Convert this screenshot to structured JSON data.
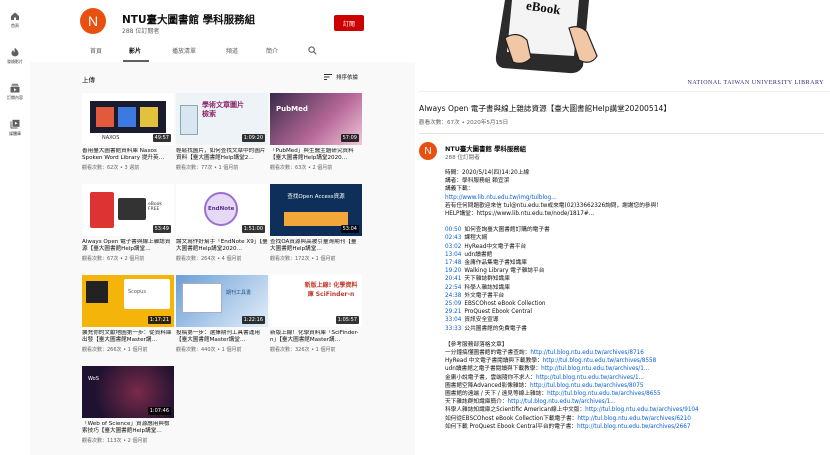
{
  "sidebar": {
    "items": [
      {
        "icon": "home-icon",
        "label": "首頁"
      },
      {
        "icon": "explore-icon",
        "label": "發燒影片"
      },
      {
        "icon": "subscriptions-icon",
        "label": "訂閱內容"
      },
      {
        "icon": "library-icon",
        "label": "媒體庫"
      }
    ]
  },
  "channel": {
    "avatar_letter": "N",
    "name": "NTU臺大圖書館 學科服務組",
    "subscribers": "288 位訂閱者",
    "subscribe_label": "訂閱",
    "tabs": [
      "首頁",
      "影片",
      "播放清單",
      "頻道",
      "簡介"
    ],
    "active_tab": "影片",
    "section_title": "上傳",
    "sort_label": "排序依據",
    "videos": [
      {
        "title": "善用臺大圖書館資料庫 Naxos Spoken Word Library 提升英…",
        "meta": "觀看次數：62次 • 3 週前",
        "duration": "49:57"
      },
      {
        "title": "輕鬆找圖片，如何查找文章中的圖片資料【臺大圖書館Help講堂2…",
        "meta": "觀看次數：77次 • 1 個月前",
        "duration": "1:09:20"
      },
      {
        "title": "「PubMed」與生醫主題研究資料【臺大圖書館Help講堂2020…",
        "meta": "觀看次數：63次 • 2 個月前",
        "duration": "57:09"
      },
      {
        "title": "Always Open 電子書與線上雜誌資源【臺大圖書館Help講堂…",
        "meta": "觀看次數：67次 • 2 個月前",
        "duration": "53:49"
      },
      {
        "title": "論文寫作好幫手「EndNote X9」【臺大圖書館Help講堂2020…",
        "meta": "觀看次數：264次 • 4 個月前",
        "duration": "1:51:00"
      },
      {
        "title": "查找OA資源與高被引臺灣期刊【臺大圖書館Help講堂…",
        "meta": "觀看次數：172次 • 1 個月前",
        "duration": "53:04"
      },
      {
        "title": "擴充你的文獻地圖第一步：從資料庫出發【臺大圖書館Master講…",
        "meta": "觀看次數：266次 • 1 個月前",
        "duration": "1:17:21"
      },
      {
        "title": "投稿第一步：選擇期刊工具書運用【臺大圖書館Master講堂…",
        "meta": "觀看次數：440次 • 1 個月前",
        "duration": "1:22:16"
      },
      {
        "title": "新版上線！化學資料庫「SciFinder-n」【臺大圖書館Master講…",
        "meta": "觀看次數：326次 • 1 個月前",
        "duration": "1:05:57"
      },
      {
        "title": "「Web of Science」資源應用與檢索技巧【臺大圖書館Help講堂…",
        "meta": "觀看次數：113次 • 2 個月前",
        "duration": "1:07:46"
      }
    ],
    "thumb_texts": [
      "NAXOS",
      "學術文章圖片檢索",
      "PubMed",
      "eBook FREE",
      "EndNote",
      "查找Open Access資源",
      "Scopus",
      "期刊工具書",
      "新版上線! 化學資料庫 SciFinder-n",
      "WoS"
    ]
  },
  "watch": {
    "ebook_word": "eBook",
    "logo": "NATIONAL TAIWAN UNIVERSITY LIBRARY",
    "title": "Always Open 電子書與線上雜誌資源【臺大圖書館Help講堂20200514】",
    "meta": "觀看次數：67次 • 2020年5月15日",
    "owner_letter": "N",
    "owner_name": "NTU臺大圖書館 學科服務組",
    "owner_subs": "288 位訂閱者",
    "info_lines": [
      "時間：2020/5/14(四)14:20上線",
      "講者：學科服務組 賴宜潔",
      "講義下載：",
      "http://www.lib.ntu.edu.tw/img/tulblog...",
      "若有任何問題歡迎來信 tul@ntu.edu.tw或來電(02)33662326詢問，謝謝您的參與！",
      "HELP講堂：https://www.lib.ntu.edu.tw/node/1817#..."
    ],
    "chapters": [
      {
        "ts": "00:50",
        "label": "如何查詢臺大圖書館訂購的電子書"
      },
      {
        "ts": "02:43",
        "label": "課程大綱"
      },
      {
        "ts": "03:02",
        "label": "HyRead中文電子書平台"
      },
      {
        "ts": "13:04",
        "label": "udn讀書館"
      },
      {
        "ts": "17:48",
        "label": "金庸作品集電子書知識庫"
      },
      {
        "ts": "19:20",
        "label": "Walking Library 電子雜誌平台"
      },
      {
        "ts": "20:41",
        "label": "天下雜誌群知識庫"
      },
      {
        "ts": "22:54",
        "label": "科學人雜誌知識庫"
      },
      {
        "ts": "24:38",
        "label": "外文電子書平台"
      },
      {
        "ts": "25:09",
        "label": "EBSCOhost eBook Collection"
      },
      {
        "ts": "29:21",
        "label": "ProQuest Ebook Central"
      },
      {
        "ts": "33:04",
        "label": "資訊安全宣導"
      },
      {
        "ts": "33:33",
        "label": "公共圖書館的免費電子書"
      }
    ],
    "ref_title": "【參考服務部落格文章】",
    "refs": [
      {
        "text": "一分鐘搞懂圖書館的電子書查詢：",
        "url": "http://tul.blog.ntu.edu.tw/archives/8716"
      },
      {
        "text": "HyRead 中文電子書閱讀與下載教學：",
        "url": "http://tul.blog.ntu.edu.tw/archives/8558"
      },
      {
        "text": "udn讀書館之電子書閱讀與下載教學：",
        "url": "http://tul.blog.ntu.edu.tw/archives/1..."
      },
      {
        "text": "金庸小說電子書，雲端隨你不求人：",
        "url": "http://tul.blog.ntu.edu.tw/archives/1..."
      },
      {
        "text": "圖書館空降Advanced影像雜誌：",
        "url": "http://tul.blog.ntu.edu.tw/archives/8075"
      },
      {
        "text": "圖書館的遠端 / 天下 / 遠見等線上雜誌：",
        "url": "http://tul.blog.ntu.edu.tw/archives/8655"
      },
      {
        "text": "天下雜誌群知識庫簡介：",
        "url": "http://tul.blog.ntu.edu.tw/archives/1..."
      },
      {
        "text": "科學人雜誌知識庫之Scientific American線上中文版：",
        "url": "http://tul.blog.ntu.edu.tw/archives/9104"
      },
      {
        "text": "如何從EBSCOhost eBook Collection下載電子書：",
        "url": "http://tul.blog.ntu.edu.tw/archives/6210"
      },
      {
        "text": "如何下載 ProQuest Ebook Central平台的電子書：",
        "url": "http://tul.blog.ntu.edu.tw/archives/2667"
      }
    ]
  }
}
